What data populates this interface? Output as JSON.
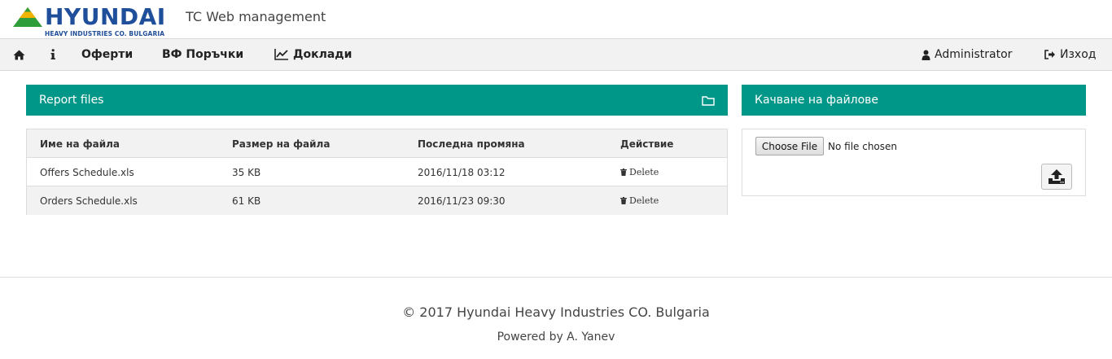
{
  "brand": {
    "name": "HYUNDAI",
    "subtitle": "HEAVY INDUSTRIES CO. BULGARIA",
    "app_title": "TC Web management",
    "colors": {
      "blue": "#1f4e9a",
      "green": "#2e9d3a",
      "yellow": "#f0b400"
    }
  },
  "nav": {
    "home_icon": "home-icon",
    "info_icon": "info-icon",
    "offers": "Оферти",
    "orders": "ВФ Поръчки",
    "reports": "Доклади",
    "user": "Administrator",
    "logout": "Изход"
  },
  "report_panel": {
    "title": "Report files",
    "columns": [
      "Име на файла",
      "Размер на файла",
      "Последна промяна",
      "Действие"
    ],
    "rows": [
      {
        "name": "Offers Schedule.xls",
        "size": "35 KB",
        "modified": "2016/11/18 03:12",
        "action": "Delete"
      },
      {
        "name": "Orders Schedule.xls",
        "size": "61 KB",
        "modified": "2016/11/23 09:30",
        "action": "Delete"
      }
    ]
  },
  "upload_panel": {
    "title": "Качване на файлове",
    "choose_label": "Choose File",
    "no_file": "No file chosen"
  },
  "footer": {
    "copyright": "© 2017 Hyundai Heavy Industries CO. Bulgaria",
    "powered": "Powered by A. Yanev"
  },
  "theme": {
    "accent": "#009688",
    "navbar_bg": "#f2f2f2"
  }
}
